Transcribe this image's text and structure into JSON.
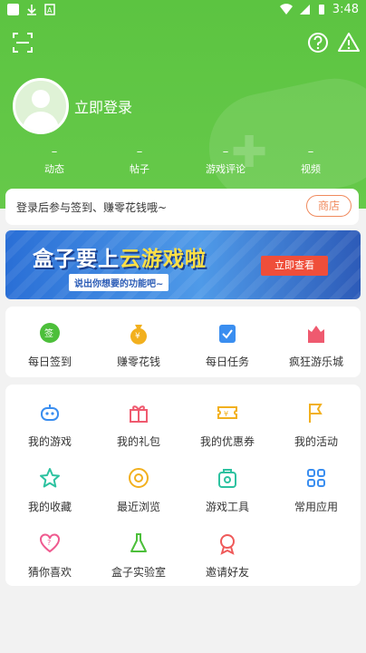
{
  "status_bar": {
    "time": "3:48"
  },
  "header": {
    "login_label": "立即登录"
  },
  "stats": [
    {
      "value": "–",
      "label": "动态"
    },
    {
      "value": "–",
      "label": "帖子"
    },
    {
      "value": "–",
      "label": "游戏评论"
    },
    {
      "value": "–",
      "label": "视频"
    }
  ],
  "notice": {
    "text": "登录后参与签到、赚零花钱哦~",
    "button": "商店"
  },
  "banner": {
    "title_a": "盒子要上",
    "title_b": "云游戏啦",
    "subtitle": "说出你想要的功能吧~",
    "cta": "立即查看"
  },
  "quick_actions": [
    {
      "label": "每日签到",
      "color": "#4cbf3a"
    },
    {
      "label": "赚零花钱",
      "color": "#f2b01e"
    },
    {
      "label": "每日任务",
      "color": "#3a8ef0"
    },
    {
      "label": "疯狂游乐城",
      "color": "#ef5a6f"
    }
  ],
  "features": [
    {
      "label": "我的游戏",
      "color": "#3a8ef0"
    },
    {
      "label": "我的礼包",
      "color": "#ef5a6f"
    },
    {
      "label": "我的优惠券",
      "color": "#f2b01e"
    },
    {
      "label": "我的活动",
      "color": "#f2b01e"
    },
    {
      "label": "我的收藏",
      "color": "#2dc2a0"
    },
    {
      "label": "最近浏览",
      "color": "#f2b01e"
    },
    {
      "label": "游戏工具",
      "color": "#2dc2a0"
    },
    {
      "label": "常用应用",
      "color": "#3a8ef0"
    },
    {
      "label": "猜你喜欢",
      "color": "#ef5a8f"
    },
    {
      "label": "盒子实验室",
      "color": "#4cbf3a"
    },
    {
      "label": "邀请好友",
      "color": "#ef5a5a"
    }
  ]
}
